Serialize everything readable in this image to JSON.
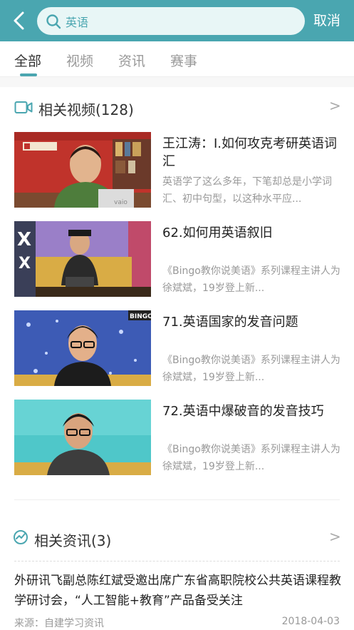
{
  "header": {
    "search_value": "英语",
    "cancel_label": "取消",
    "bar_color": "#4aa6b0"
  },
  "tabs": [
    {
      "label": "全部",
      "active": true
    },
    {
      "label": "视频",
      "active": false
    },
    {
      "label": "资讯",
      "active": false
    },
    {
      "label": "赛事",
      "active": false
    }
  ],
  "videos_section": {
    "title": "相关视频(128)",
    "more": ">",
    "icon": "video-camera-icon",
    "items": [
      {
        "title": "王江涛：Ⅰ.如何攻克考研英语词汇",
        "desc": "英语学了这么多年，下笔却总是小学词汇、初中句型，以这种水平应..."
      },
      {
        "title": "62.如何用英语叙旧",
        "desc": "《Bingo教你说美语》系列课程主讲人为徐斌斌，19岁登上新..."
      },
      {
        "title": "71.英语国家的发音问题",
        "desc": "《Bingo教你说美语》系列课程主讲人为徐斌斌，19岁登上新..."
      },
      {
        "title": "72.英语中爆破音的发音技巧",
        "desc": "《Bingo教你说美语》系列课程主讲人为徐斌斌，19岁登上新..."
      }
    ]
  },
  "news_section": {
    "title": "相关资讯(3)",
    "more": ">",
    "icon": "news-icon",
    "article": {
      "title": "外研讯飞副总陈红斌受邀出席广东省高职院校公共英语课程教学研讨会，“人工智能+教育”产品备受关注",
      "source": "来源：自建学习资讯",
      "date": "2018-04-03"
    }
  }
}
